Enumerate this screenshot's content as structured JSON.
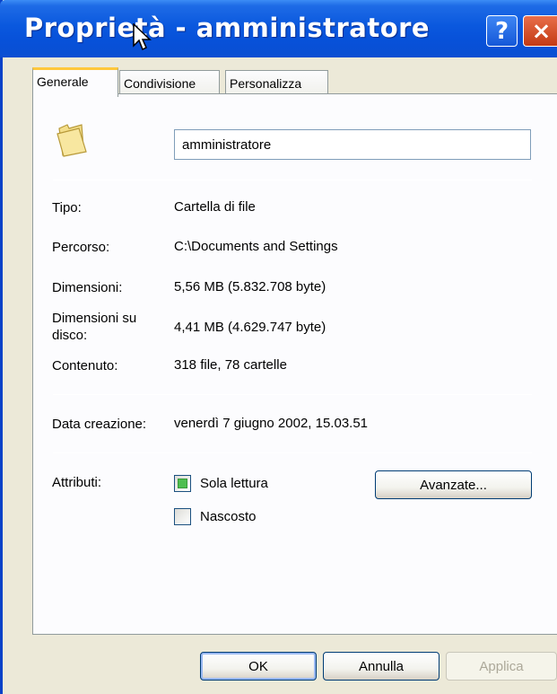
{
  "window": {
    "title": "Proprietà - amministratore",
    "help_glyph": "?",
    "close_glyph": "×"
  },
  "tabs": [
    {
      "label": "Generale",
      "active": true
    },
    {
      "label": "Condivisione",
      "active": false
    },
    {
      "label": "Personalizza",
      "active": false
    }
  ],
  "general": {
    "name_value": "amministratore",
    "type_label": "Tipo:",
    "type_value": "Cartella di file",
    "path_label": "Percorso:",
    "path_value": "C:\\Documents and Settings",
    "size_label": "Dimensioni:",
    "size_value": "5,56 MB (5.832.708 byte)",
    "disk_size_label_line1": "Dimensioni su",
    "disk_size_label_line2": "disco:",
    "disk_size_value": "4,41 MB (4.629.747 byte)",
    "contents_label": "Contenuto:",
    "contents_value": "318 file, 78 cartelle",
    "created_label": "Data creazione:",
    "created_value": "venerdì 7 giugno 2002, 15.03.51",
    "attributes_label": "Attributi:",
    "readonly_label": "Sola lettura",
    "readonly_state": "partial",
    "hidden_label": "Nascosto",
    "hidden_checked": false,
    "advanced_button": "Avanzate..."
  },
  "footer": {
    "ok": "OK",
    "cancel": "Annulla",
    "apply": "Applica"
  },
  "icons": {
    "folder": "folder-icon",
    "cursor": "mouse-pointer-icon"
  },
  "colors": {
    "titlebar": "#0A58DE",
    "dialog_bg": "#ECE9D8",
    "tab_accent": "#FFC83C",
    "close": "#D2532C"
  }
}
